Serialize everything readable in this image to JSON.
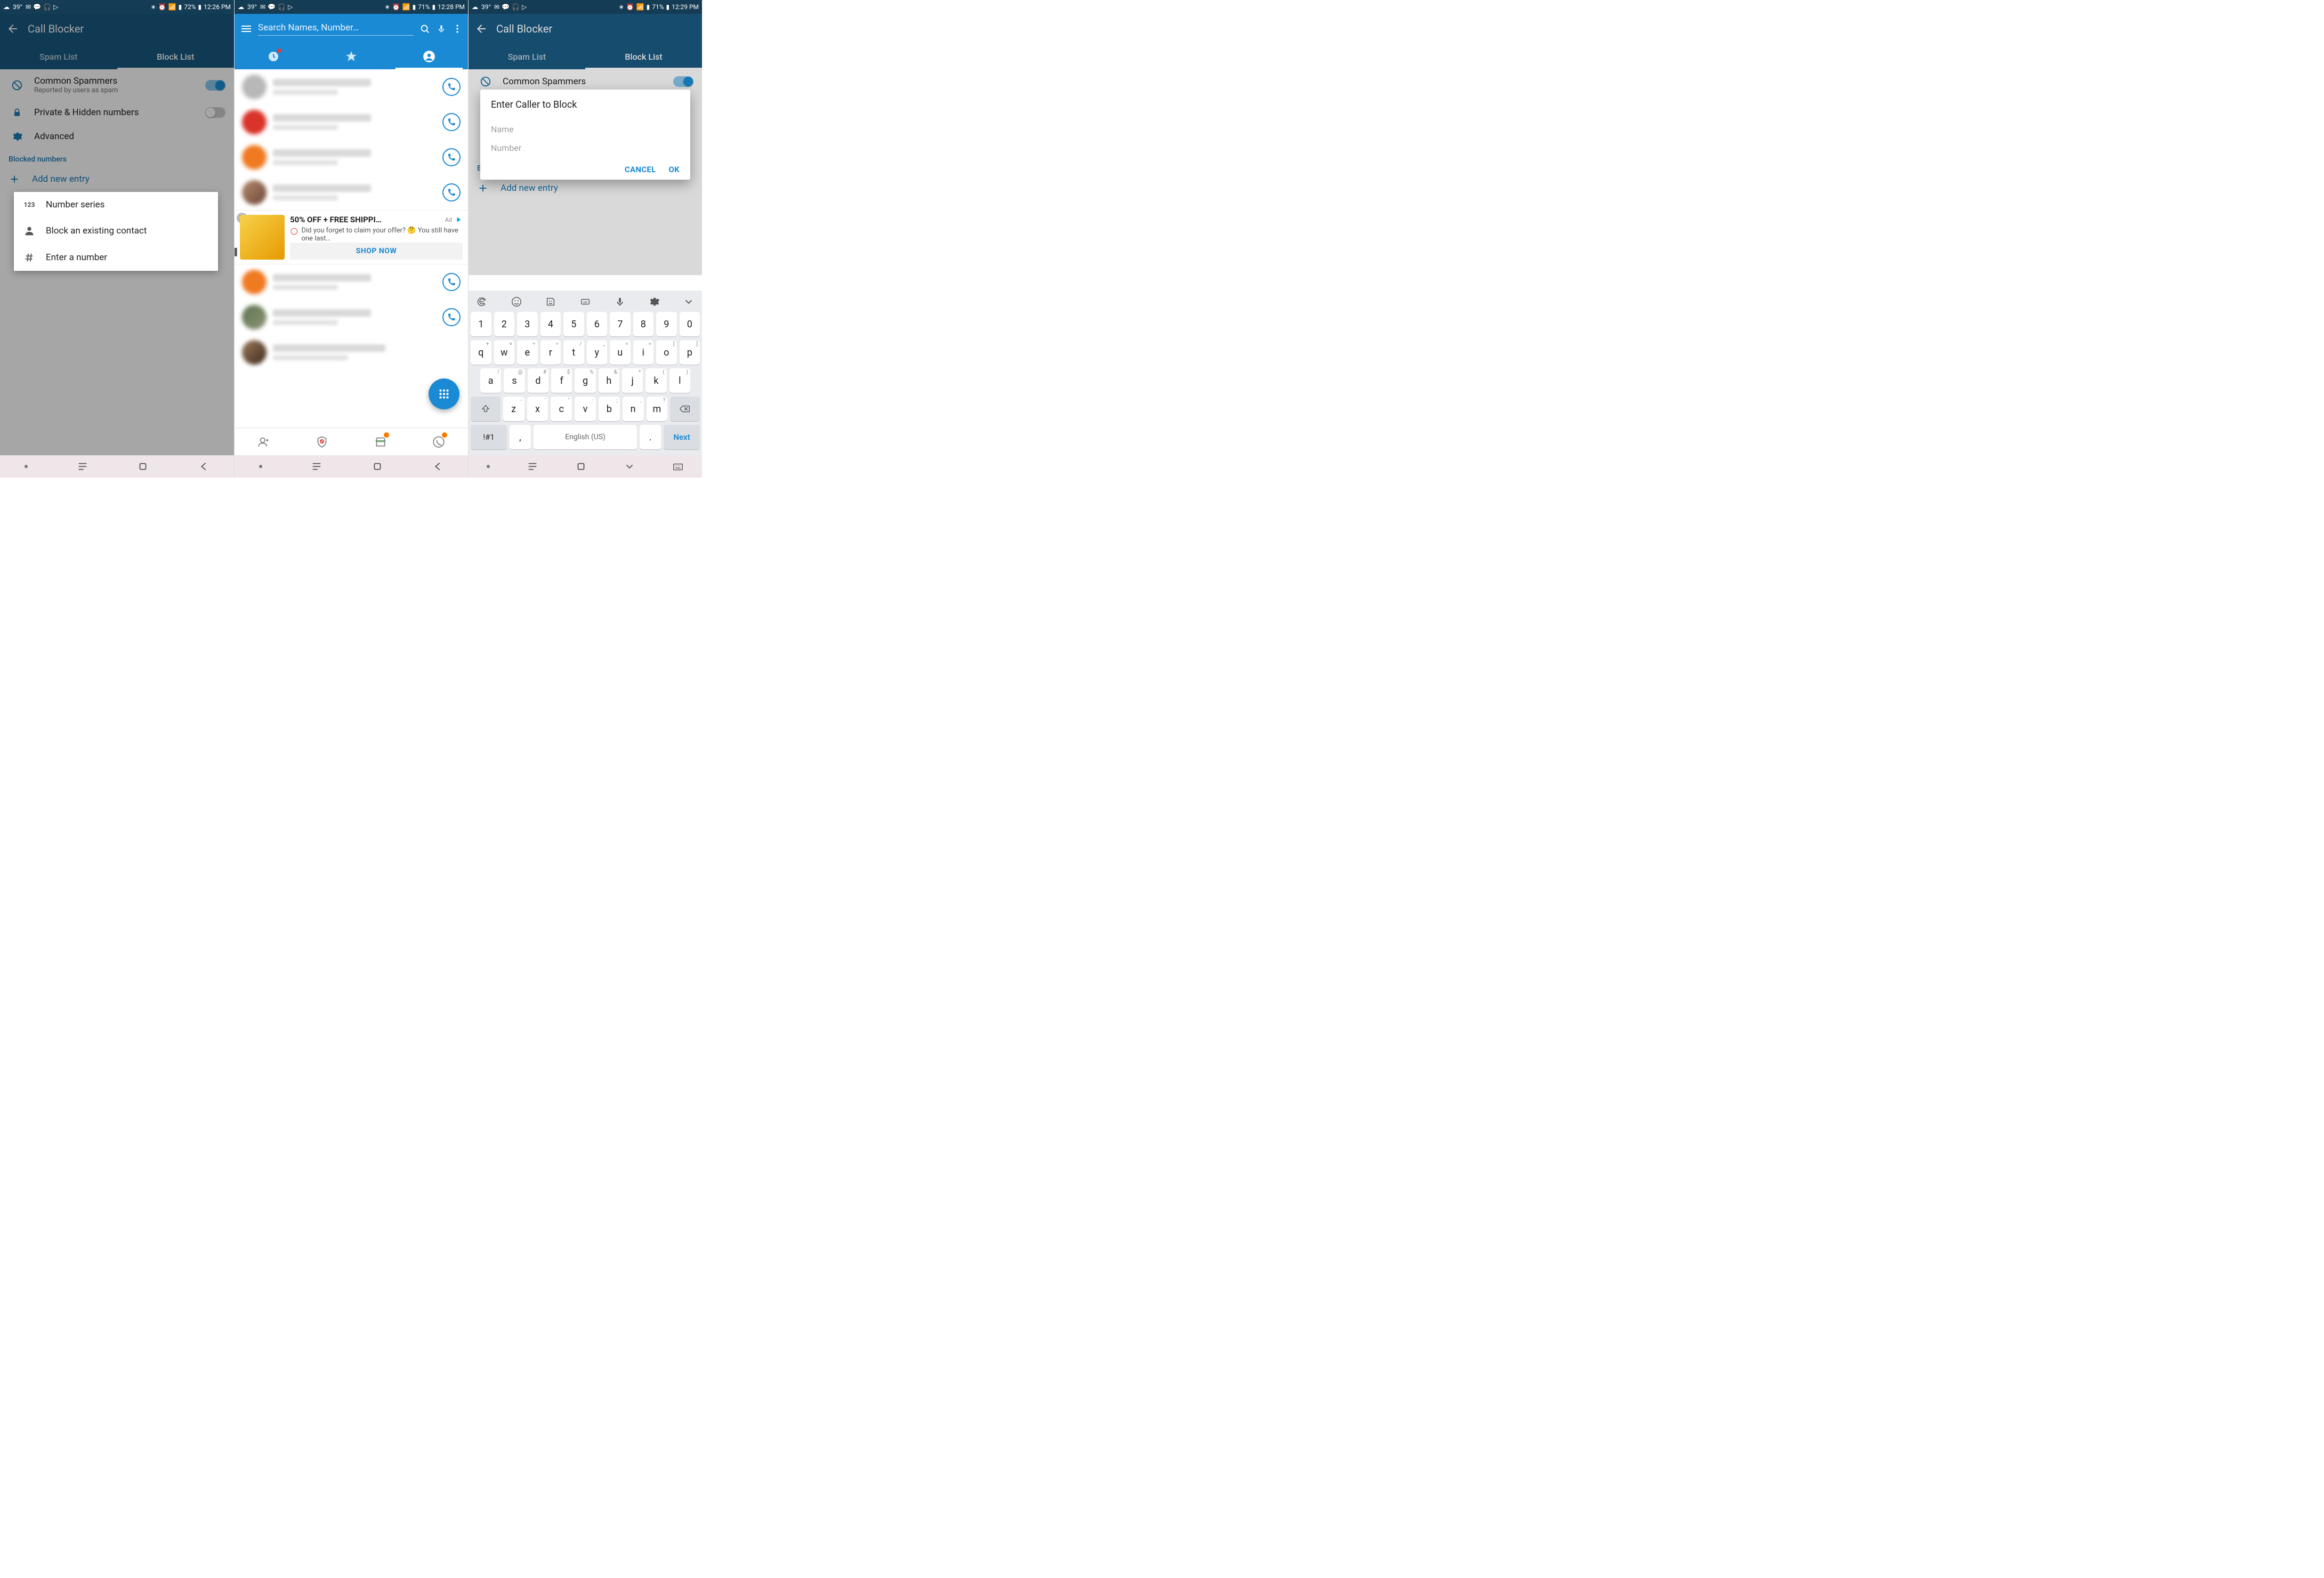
{
  "phone1": {
    "status": {
      "temp": "39°",
      "battery": "72%",
      "time": "12:26 PM"
    },
    "appTitle": "Call Blocker",
    "tabs": {
      "spam": "Spam List",
      "block": "Block List"
    },
    "rows": {
      "common": {
        "title": "Common Spammers",
        "sub": "Reported by users as spam"
      },
      "private": {
        "title": "Private & Hidden numbers"
      },
      "advanced": {
        "title": "Advanced"
      }
    },
    "sectionHeader": "Blocked numbers",
    "addEntry": "Add new entry",
    "menu": {
      "series": "Number series",
      "contact": "Block an existing contact",
      "number": "Enter a number"
    }
  },
  "phone2": {
    "status": {
      "temp": "39°",
      "battery": "71%",
      "time": "12:28 PM"
    },
    "searchPlaceholder": "Search Names, Number…",
    "ad": {
      "title": "50% OFF + FREE SHIPPI…",
      "label": "Ad",
      "desc": "Did you forget to claim your offer? 🤔 You still have one last…",
      "cta": "SHOP NOW"
    }
  },
  "phone3": {
    "status": {
      "temp": "39°",
      "battery": "71%",
      "time": "12:29 PM"
    },
    "appTitle": "Call Blocker",
    "tabs": {
      "spam": "Spam List",
      "block": "Block List"
    },
    "rows": {
      "common": {
        "title": "Common Spammers"
      }
    },
    "sectionHeader": "B",
    "addEntry": "Add new entry",
    "dialog": {
      "title": "Enter Caller to Block",
      "name": "Name",
      "number": "Number",
      "cancel": "CANCEL",
      "ok": "OK"
    },
    "keyboard": {
      "row1": [
        "1",
        "2",
        "3",
        "4",
        "5",
        "6",
        "7",
        "8",
        "9",
        "0"
      ],
      "row2": [
        {
          "k": "q",
          "s": "+"
        },
        {
          "k": "w",
          "s": "×"
        },
        {
          "k": "e",
          "s": "÷"
        },
        {
          "k": "r",
          "s": "="
        },
        {
          "k": "t",
          "s": "/"
        },
        {
          "k": "y",
          "s": "_"
        },
        {
          "k": "u",
          "s": "<"
        },
        {
          "k": "i",
          "s": ">"
        },
        {
          "k": "o",
          "s": "["
        },
        {
          "k": "p",
          "s": "]"
        }
      ],
      "row3": [
        {
          "k": "a",
          "s": "!"
        },
        {
          "k": "s",
          "s": "@"
        },
        {
          "k": "d",
          "s": "#"
        },
        {
          "k": "f",
          "s": "$"
        },
        {
          "k": "g",
          "s": "%"
        },
        {
          "k": "h",
          "s": "&"
        },
        {
          "k": "j",
          "s": "*"
        },
        {
          "k": "k",
          "s": "("
        },
        {
          "k": "l",
          "s": ")"
        }
      ],
      "row4": [
        {
          "k": "z",
          "s": "-"
        },
        {
          "k": "x",
          "s": "'"
        },
        {
          "k": "c",
          "s": "\""
        },
        {
          "k": "v",
          "s": ":"
        },
        {
          "k": "b",
          "s": ";"
        },
        {
          "k": "n",
          "s": ","
        },
        {
          "k": "m",
          "s": "?"
        }
      ],
      "symKey": "!#1",
      "commaKey": ",",
      "space": "English (US)",
      "periodKey": ".",
      "next": "Next"
    }
  }
}
